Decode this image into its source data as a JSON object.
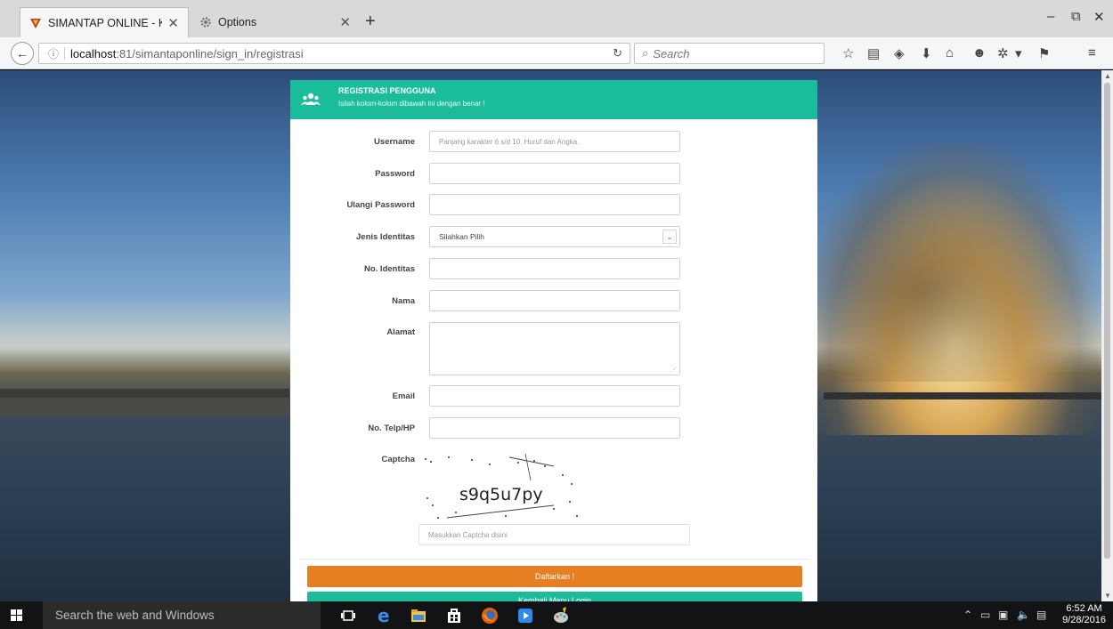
{
  "browser": {
    "tabs": [
      {
        "title": "SIMANTAP ONLINE - KOT...",
        "active": true
      },
      {
        "title": "Options",
        "active": false
      }
    ],
    "url_host": "localhost",
    "url_path": ":81/simantaponline/sign_in/registrasi",
    "search_placeholder": "Search",
    "window_controls": {
      "minimize": "–",
      "maximize": "⧉",
      "close": "✕"
    }
  },
  "form": {
    "header": {
      "title": "REGISTRASI PENGGUNA",
      "subtitle": "Isilah kolom-kolom dibawah ini dengan benar !"
    },
    "fields": {
      "username": {
        "label": "Username",
        "placeholder": "Panjang karakter 6 s/d 10. Huruf dan Angka.",
        "value": ""
      },
      "password": {
        "label": "Password",
        "value": ""
      },
      "ulangi_password": {
        "label": "Ulangi Password",
        "value": ""
      },
      "jenis_identitas": {
        "label": "Jenis Identitas",
        "selected": "Silahkan Pilih"
      },
      "no_identitas": {
        "label": "No. Identitas",
        "value": ""
      },
      "nama": {
        "label": "Nama",
        "value": ""
      },
      "alamat": {
        "label": "Alamat",
        "value": ""
      },
      "email": {
        "label": "Email",
        "value": ""
      },
      "no_telp": {
        "label": "No. Telp/HP",
        "value": ""
      },
      "captcha": {
        "label": "Captcha",
        "code": "s9q5u7py",
        "placeholder": "Masukkan Captcha disini"
      }
    },
    "buttons": {
      "submit": "Daftarkan !",
      "back": "Kembali Menu Login"
    },
    "colors": {
      "accent": "#1abc9c",
      "submit": "#e67e22"
    }
  },
  "taskbar": {
    "search_placeholder": "Search the web and Windows",
    "time": "6:52 AM",
    "date": "9/28/2016"
  }
}
